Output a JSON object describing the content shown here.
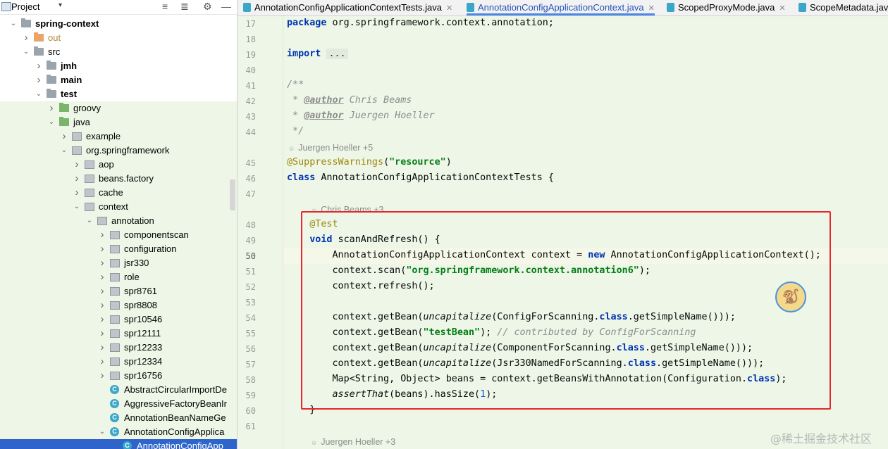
{
  "project_panel": {
    "title": "Project",
    "tree": [
      {
        "label": "spring-context",
        "depth": 0,
        "arrow": "down",
        "icon": "module",
        "bold": true
      },
      {
        "label": "out",
        "depth": 1,
        "arrow": "right",
        "icon": "folder-orange",
        "color": "#b08a3c"
      },
      {
        "label": "src",
        "depth": 1,
        "arrow": "down",
        "icon": "folder"
      },
      {
        "label": "jmh",
        "depth": 2,
        "arrow": "right",
        "icon": "folder",
        "bold": true
      },
      {
        "label": "main",
        "depth": 2,
        "arrow": "right",
        "icon": "folder",
        "bold": true
      },
      {
        "label": "test",
        "depth": 2,
        "arrow": "down",
        "icon": "folder",
        "bold": true
      },
      {
        "label": "groovy",
        "depth": 3,
        "arrow": "right",
        "icon": "folder-green",
        "green": true
      },
      {
        "label": "java",
        "depth": 3,
        "arrow": "down",
        "icon": "folder-green",
        "green": true
      },
      {
        "label": "example",
        "depth": 4,
        "arrow": "right",
        "icon": "package",
        "green": true
      },
      {
        "label": "org.springframework",
        "depth": 4,
        "arrow": "down",
        "icon": "package",
        "green": true
      },
      {
        "label": "aop",
        "depth": 5,
        "arrow": "right",
        "icon": "package",
        "green": true
      },
      {
        "label": "beans.factory",
        "depth": 5,
        "arrow": "right",
        "icon": "package",
        "green": true
      },
      {
        "label": "cache",
        "depth": 5,
        "arrow": "right",
        "icon": "package",
        "green": true
      },
      {
        "label": "context",
        "depth": 5,
        "arrow": "down",
        "icon": "package",
        "green": true
      },
      {
        "label": "annotation",
        "depth": 6,
        "arrow": "down",
        "icon": "package",
        "green": true
      },
      {
        "label": "componentscan",
        "depth": 7,
        "arrow": "right",
        "icon": "package",
        "green": true
      },
      {
        "label": "configuration",
        "depth": 7,
        "arrow": "right",
        "icon": "package",
        "green": true
      },
      {
        "label": "jsr330",
        "depth": 7,
        "arrow": "right",
        "icon": "package",
        "green": true
      },
      {
        "label": "role",
        "depth": 7,
        "arrow": "right",
        "icon": "package",
        "green": true
      },
      {
        "label": "spr8761",
        "depth": 7,
        "arrow": "right",
        "icon": "package",
        "green": true
      },
      {
        "label": "spr8808",
        "depth": 7,
        "arrow": "right",
        "icon": "package",
        "green": true
      },
      {
        "label": "spr10546",
        "depth": 7,
        "arrow": "right",
        "icon": "package",
        "green": true
      },
      {
        "label": "spr12111",
        "depth": 7,
        "arrow": "right",
        "icon": "package",
        "green": true
      },
      {
        "label": "spr12233",
        "depth": 7,
        "arrow": "right",
        "icon": "package",
        "green": true
      },
      {
        "label": "spr12334",
        "depth": 7,
        "arrow": "right",
        "icon": "package",
        "green": true
      },
      {
        "label": "spr16756",
        "depth": 7,
        "arrow": "right",
        "icon": "package",
        "green": true
      },
      {
        "label": "AbstractCircularImportDe",
        "depth": 7,
        "arrow": "",
        "icon": "class",
        "green": true
      },
      {
        "label": "AggressiveFactoryBeanIr",
        "depth": 7,
        "arrow": "",
        "icon": "class",
        "green": true
      },
      {
        "label": "AnnotationBeanNameGe",
        "depth": 7,
        "arrow": "",
        "icon": "class",
        "green": true
      },
      {
        "label": "AnnotationConfigApplica",
        "depth": 7,
        "arrow": "down",
        "icon": "class",
        "green": true
      },
      {
        "label": "AnnotationConfigApp",
        "depth": 8,
        "arrow": "",
        "icon": "class",
        "selected": true
      }
    ]
  },
  "tabs": [
    {
      "label": "AnnotationConfigApplicationContextTests.java",
      "active": false
    },
    {
      "label": "AnnotationConfigApplicationContext.java",
      "active": true
    },
    {
      "label": "ScopedProxyMode.java",
      "active": false
    },
    {
      "label": "ScopeMetadata.java",
      "active": false
    }
  ],
  "editor": {
    "lines": [
      {
        "n": "17",
        "html": "<span class='kw'>package</span> org.springframework.context.annotation;"
      },
      {
        "n": "18",
        "html": ""
      },
      {
        "n": "19",
        "html": "<span class='kw'>import</span> <span class='fold'>...</span>"
      },
      {
        "n": "40",
        "html": ""
      },
      {
        "n": "41",
        "html": "<span class='cmt'>/**</span>"
      },
      {
        "n": "42",
        "html": "<span class='cmt'> * </span><span class='doctag'>@author</span><span class='cmt'> Chris Beams</span>"
      },
      {
        "n": "43",
        "html": "<span class='cmt'> * </span><span class='doctag'>@author</span><span class='cmt'> Juergen Hoeller</span>"
      },
      {
        "n": "44",
        "html": "<span class='cmt'> */</span>"
      },
      {
        "hint": "Juergen Hoeller +5",
        "indent": 0
      },
      {
        "n": "45",
        "html": "<span class='ann'>@SuppressWarnings</span>(<span class='str'>\"resource\"</span>)"
      },
      {
        "n": "46",
        "html": "<span class='kw'>class</span> AnnotationConfigApplicationContextTests {"
      },
      {
        "n": "47",
        "html": ""
      },
      {
        "hint": "Chris Beams +3",
        "indent": 1
      },
      {
        "n": "48",
        "html": "    <span class='ann'>@Test</span>"
      },
      {
        "n": "49",
        "html": "    <span class='kw'>void</span> scanAndRefresh() {"
      },
      {
        "n": "50",
        "html": "        AnnotationConfigApplicationContext context = <span class='kw'>new</span> AnnotationConfigApplicationContext();"
      },
      {
        "n": "51",
        "html": "        context.scan(<span class='str'>\"org.springframework.context.annotation6\"</span>);"
      },
      {
        "n": "52",
        "html": "        context.refresh();"
      },
      {
        "n": "53",
        "html": ""
      },
      {
        "n": "54",
        "html": "        context.getBean(<span class='ital'>uncapitalize</span>(ConfigForScanning.<span class='kw'>class</span>.getSimpleName()));"
      },
      {
        "n": "55",
        "html": "        context.getBean(<span class='str'>\"testBean\"</span>); <span class='cmt'>// contributed by ConfigForScanning</span>"
      },
      {
        "n": "56",
        "html": "        context.getBean(<span class='ital'>uncapitalize</span>(ComponentForScanning.<span class='kw'>class</span>.getSimpleName()));"
      },
      {
        "n": "57",
        "html": "        context.getBean(<span class='ital'>uncapitalize</span>(Jsr330NamedForScanning.<span class='kw'>class</span>.getSimpleName()));"
      },
      {
        "n": "58",
        "html": "        Map&lt;String, Object&gt; beans = context.getBeansWithAnnotation(Configuration.<span class='kw'>class</span>);"
      },
      {
        "n": "59",
        "html": "        <span class='ital'>assertThat</span>(beans).hasSize(<span class='num'>1</span>);"
      },
      {
        "n": "60",
        "html": "    }"
      },
      {
        "n": "61",
        "html": ""
      },
      {
        "hint": "Juergen Hoeller +3",
        "indent": 1
      }
    ],
    "current_line": "50"
  },
  "watermark": "@稀土掘金技术社区"
}
